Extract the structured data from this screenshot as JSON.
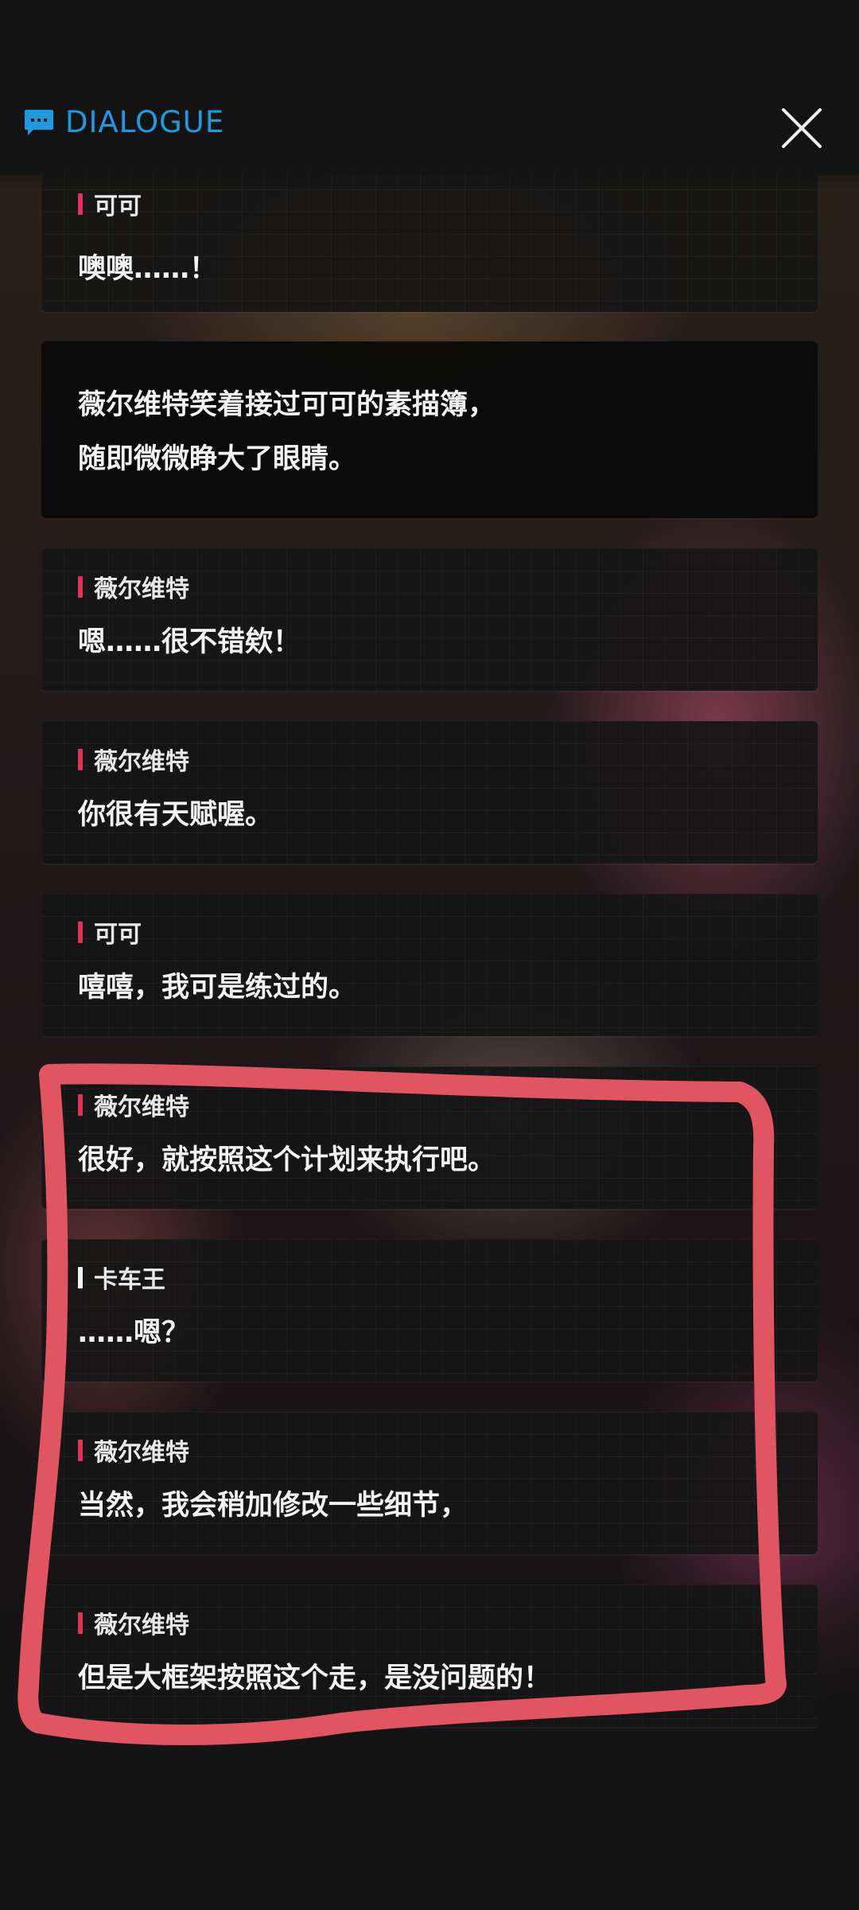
{
  "header": {
    "title": "DIALOGUE",
    "title_color": "#1e9be0",
    "icon": "chat-bubble-icon",
    "close_icon": "close-icon"
  },
  "colors": {
    "speaker_bar": "#e0345a",
    "annotation_stroke": "#e05561"
  },
  "entries": [
    {
      "type": "dialogue",
      "speaker": "可可",
      "text": "噢噢……！"
    },
    {
      "type": "narration",
      "lines": [
        "薇尔维特笑着接过可可的素描簿，",
        "随即微微睁大了眼睛。"
      ]
    },
    {
      "type": "dialogue",
      "speaker": "薇尔维特",
      "text": "嗯……很不错欸！"
    },
    {
      "type": "dialogue",
      "speaker": "薇尔维特",
      "text": "你很有天赋喔。"
    },
    {
      "type": "dialogue",
      "speaker": "可可",
      "text": "嘻嘻，我可是练过的。"
    },
    {
      "type": "dialogue",
      "speaker": "薇尔维特",
      "text": "很好，就按照这个计划来执行吧。"
    },
    {
      "type": "dialogue",
      "speaker": "卡车王",
      "text": "……嗯？"
    },
    {
      "type": "dialogue",
      "speaker": "薇尔维特",
      "text": "当然，我会稍加修改一些细节，"
    },
    {
      "type": "dialogue",
      "speaker": "薇尔维特",
      "text": "但是大框架按照这个走，是没问题的！"
    }
  ]
}
